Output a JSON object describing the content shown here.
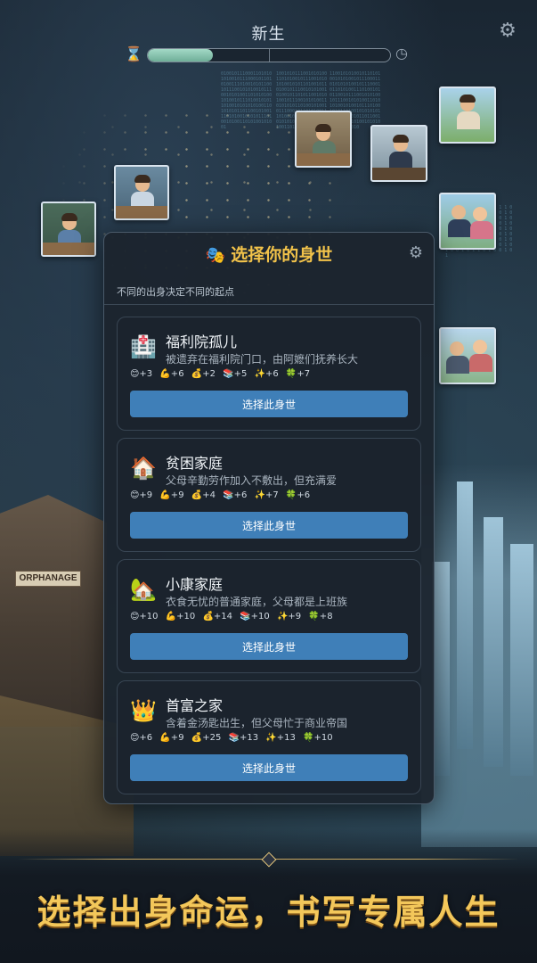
{
  "header": {
    "title": "新生",
    "progress_fraction": 0.27,
    "gear_icon": "gear-icon",
    "hourglass_icon": "hourglass-icon",
    "clock_icon": "clock-icon"
  },
  "background": {
    "orphanage_sign": "ORPHANAGE"
  },
  "panel": {
    "title": "选择你的身世",
    "subtitle": "不同的出身决定不同的起点",
    "cards": [
      {
        "icon": "hospital-icon",
        "icon_glyph": "🏥",
        "title": "福利院孤儿",
        "desc": "被遗弃在福利院门口，由阿嬷们抚养长大",
        "stats": [
          "😊+3",
          "💪+6",
          "💰+2",
          "📚+5",
          "✨+6",
          "🍀+7"
        ],
        "button": "选择此身世"
      },
      {
        "icon": "house-icon",
        "icon_glyph": "🏠",
        "title": "贫困家庭",
        "desc": "父母辛勤劳作加入不敷出，但充满爱",
        "stats": [
          "😊+9",
          "💪+9",
          "💰+4",
          "📚+6",
          "✨+7",
          "🍀+6"
        ],
        "button": "选择此身世"
      },
      {
        "icon": "house-garden-icon",
        "icon_glyph": "🏡",
        "title": "小康家庭",
        "desc": "衣食无忧的普通家庭，父母都是上班族",
        "stats": [
          "😊+10",
          "💪+10",
          "💰+14",
          "📚+10",
          "✨+9",
          "🍀+8"
        ],
        "button": "选择此身世"
      },
      {
        "icon": "crown-icon",
        "icon_glyph": "👑",
        "title": "首富之家",
        "desc": "含着金汤匙出生，但父母忙于商业帝国",
        "stats": [
          "😊+6",
          "💪+9",
          "💰+25",
          "📚+13",
          "✨+13",
          "🍀+10"
        ],
        "button": "选择此身世"
      }
    ]
  },
  "footer": {
    "slogan": "选择出身命运，书写专属人生"
  },
  "colors": {
    "accent_gold": "#f1c24a",
    "button_blue": "#3f7fb8",
    "panel_bg": "#1c242e"
  }
}
